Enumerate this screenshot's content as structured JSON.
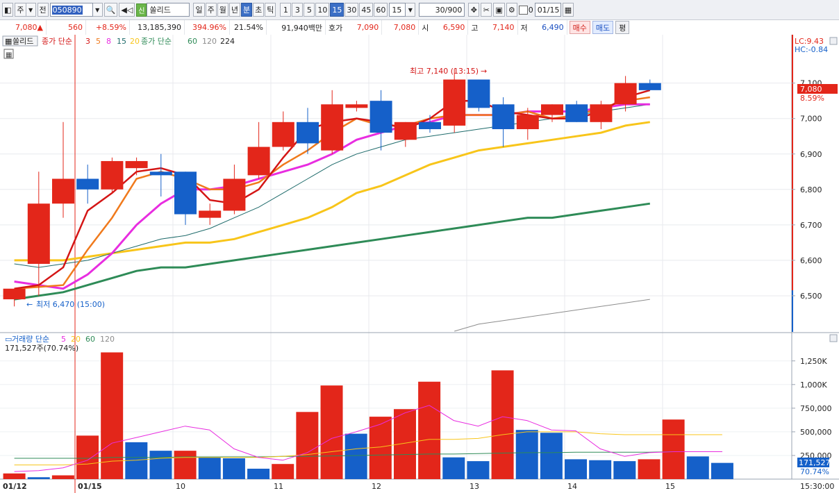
{
  "toolbar": {
    "type": "주",
    "range": "전",
    "code": "050890",
    "name_badge": "신",
    "name": "쏠리드",
    "periods": [
      "일",
      "주",
      "월",
      "년",
      "분",
      "초",
      "틱"
    ],
    "active_period": "분",
    "intervals": [
      "1",
      "3",
      "5",
      "10",
      "15",
      "30",
      "45",
      "60"
    ],
    "active_interval": "15",
    "interval_value": "15",
    "count": "30",
    "count_max": "/900",
    "checkbox_label": "0",
    "date": "01/15"
  },
  "quote": {
    "price": "7,080",
    "up_symbol": "▲",
    "change": "560",
    "change_pct": "+8.59%",
    "volume": "13,185,390",
    "volume_ratio": "394.96%",
    "turnover": "21.54%",
    "amount": "91,940백만",
    "bid_label": "호가",
    "bid1": "7,090",
    "bid2": "7,080",
    "open_label": "시",
    "open": "6,590",
    "high_label": "고",
    "high": "7,140",
    "low_label": "저",
    "low": "6,490",
    "buy_button": "매수",
    "sell_button": "매도",
    "avg_button": "평"
  },
  "chart": {
    "name_label": "쏠리드",
    "ma_label": "종가 단순",
    "ma_periods": [
      "3",
      "5",
      "8",
      "15",
      "20"
    ],
    "ma2_label": "종가 단순",
    "ma2_periods": [
      "60",
      "120",
      "224"
    ],
    "lc": "LC:9.43",
    "hc": "HC:-0.84",
    "current_price": "7,080",
    "current_pct": "8.59%",
    "high_annot": "최고 7,140 (13:15)",
    "low_annot": "최저 6,470 (15:00)",
    "vol_label": "거래량 단순",
    "vol_periods": [
      "5",
      "20",
      "60",
      "120"
    ],
    "vol_current": "171,527주(70.74%)",
    "vol_current_value": "171,527",
    "vol_current_pct": "70.74%",
    "time_label": "15:30:00",
    "colors": {
      "up": "#e3261a",
      "down": "#1560c9",
      "ma3": "#d41515",
      "ma5": "#f07a1c",
      "ma8": "#e82de0",
      "ma15": "#1d6a6a",
      "ma20": "#f8c51a",
      "ma60": "#2e8b57",
      "ma120": "#8c8c8c"
    }
  },
  "chart_data": {
    "type": "candlestick",
    "price_axis": {
      "ticks": [
        "7,100",
        "7,000",
        "6,900",
        "6,800",
        "6,700",
        "6,600",
        "6,500"
      ],
      "range": [
        6400,
        7200
      ]
    },
    "volume_axis": {
      "ticks": [
        "1,250K",
        "1,000K",
        "750,000",
        "500,000",
        "250,000"
      ],
      "range": [
        0,
        1350000
      ]
    },
    "x_labels": [
      "01/12",
      "01/15",
      "10",
      "11",
      "12",
      "13",
      "14",
      "15"
    ],
    "candles": [
      {
        "o": 6490,
        "h": 6520,
        "l": 6470,
        "c": 6520
      },
      {
        "o": 6590,
        "h": 6850,
        "l": 6500,
        "c": 6760
      },
      {
        "o": 6760,
        "h": 6990,
        "l": 6720,
        "c": 6830
      },
      {
        "o": 6830,
        "h": 6870,
        "l": 6760,
        "c": 6800
      },
      {
        "o": 6800,
        "h": 6890,
        "l": 6790,
        "c": 6880
      },
      {
        "o": 6860,
        "h": 6890,
        "l": 6840,
        "c": 6880
      },
      {
        "o": 6850,
        "h": 6900,
        "l": 6780,
        "c": 6840
      },
      {
        "o": 6850,
        "h": 6850,
        "l": 6700,
        "c": 6730
      },
      {
        "o": 6720,
        "h": 6760,
        "l": 6700,
        "c": 6740
      },
      {
        "o": 6740,
        "h": 6870,
        "l": 6730,
        "c": 6830
      },
      {
        "o": 6840,
        "h": 6990,
        "l": 6830,
        "c": 6920
      },
      {
        "o": 6920,
        "h": 7020,
        "l": 6910,
        "c": 6990
      },
      {
        "o": 6990,
        "h": 7030,
        "l": 6900,
        "c": 6930
      },
      {
        "o": 6910,
        "h": 7080,
        "l": 6900,
        "c": 7040
      },
      {
        "o": 7030,
        "h": 7050,
        "l": 7020,
        "c": 7040
      },
      {
        "o": 7050,
        "h": 7080,
        "l": 6910,
        "c": 6960
      },
      {
        "o": 6940,
        "h": 6990,
        "l": 6920,
        "c": 6990
      },
      {
        "o": 6990,
        "h": 7010,
        "l": 6960,
        "c": 6970
      },
      {
        "o": 6980,
        "h": 7140,
        "l": 6960,
        "c": 7110
      },
      {
        "o": 7110,
        "h": 7110,
        "l": 7020,
        "c": 7030
      },
      {
        "o": 7040,
        "h": 7060,
        "l": 6920,
        "c": 6970
      },
      {
        "o": 6970,
        "h": 7030,
        "l": 6940,
        "c": 7010
      },
      {
        "o": 7010,
        "h": 7040,
        "l": 6990,
        "c": 7040
      },
      {
        "o": 7040,
        "h": 7050,
        "l": 6990,
        "c": 6990
      },
      {
        "o": 6990,
        "h": 7050,
        "l": 6970,
        "c": 7040
      },
      {
        "o": 7040,
        "h": 7120,
        "l": 7020,
        "c": 7100
      },
      {
        "o": 7100,
        "h": 7110,
        "l": 7080,
        "c": 7080
      }
    ],
    "volumes": [
      {
        "v": 60000,
        "up": true
      },
      {
        "v": 20000,
        "up": false
      },
      {
        "v": 40000,
        "up": true
      },
      {
        "v": 460000,
        "up": true
      },
      {
        "v": 1340000,
        "up": true
      },
      {
        "v": 390000,
        "up": false
      },
      {
        "v": 300000,
        "up": false
      },
      {
        "v": 300000,
        "up": true
      },
      {
        "v": 230000,
        "up": false
      },
      {
        "v": 220000,
        "up": false
      },
      {
        "v": 110000,
        "up": false
      },
      {
        "v": 160000,
        "up": true
      },
      {
        "v": 710000,
        "up": true
      },
      {
        "v": 990000,
        "up": true
      },
      {
        "v": 480000,
        "up": false
      },
      {
        "v": 660000,
        "up": true
      },
      {
        "v": 740000,
        "up": true
      },
      {
        "v": 1030000,
        "up": true
      },
      {
        "v": 230000,
        "up": false
      },
      {
        "v": 190000,
        "up": false
      },
      {
        "v": 1150000,
        "up": true
      },
      {
        "v": 520000,
        "up": false
      },
      {
        "v": 490000,
        "up": false
      },
      {
        "v": 210000,
        "up": false
      },
      {
        "v": 200000,
        "up": false
      },
      {
        "v": 190000,
        "up": false
      },
      {
        "v": 210000,
        "up": true
      },
      {
        "v": 630000,
        "up": true
      },
      {
        "v": 240000,
        "up": false
      },
      {
        "v": 171527,
        "up": false
      }
    ],
    "ma_lines": {
      "ma3": [
        6520,
        6530,
        6580,
        6740,
        6790,
        6850,
        6860,
        6840,
        6770,
        6760,
        6800,
        6890,
        6970,
        6990,
        7000,
        6990,
        6970,
        7000,
        7050,
        7050,
        7020,
        7010,
        7000,
        7000,
        7020,
        7060,
        7080
      ],
      "ma5": [
        6520,
        6525,
        6530,
        6630,
        6720,
        6830,
        6850,
        6830,
        6800,
        6800,
        6820,
        6870,
        6910,
        6960,
        7000,
        6980,
        6980,
        7000,
        7010,
        7010,
        7010,
        7020,
        7000,
        7010,
        7030,
        7050,
        7060
      ],
      "ma8": [
        6540,
        6530,
        6520,
        6560,
        6620,
        6700,
        6760,
        6800,
        6800,
        6810,
        6830,
        6850,
        6870,
        6900,
        6940,
        6960,
        6980,
        6990,
        7010,
        7010,
        7010,
        7020,
        7020,
        7020,
        7030,
        7040,
        7040
      ],
      "ma15": [
        6590,
        6580,
        6590,
        6600,
        6620,
        6640,
        6660,
        6670,
        6690,
        6720,
        6750,
        6790,
        6830,
        6870,
        6900,
        6920,
        6940,
        6950,
        6960,
        6970,
        6980,
        6990,
        7000,
        7010,
        7020,
        7030,
        7040
      ],
      "ma20": [
        6600,
        6600,
        6600,
        6610,
        6620,
        6630,
        6640,
        6650,
        6650,
        6660,
        6680,
        6700,
        6720,
        6750,
        6790,
        6810,
        6840,
        6870,
        6890,
        6910,
        6920,
        6930,
        6940,
        6950,
        6960,
        6980,
        6990
      ],
      "ma60": [
        6490,
        6500,
        6510,
        6530,
        6550,
        6570,
        6580,
        6580,
        6590,
        6600,
        6610,
        6620,
        6630,
        6640,
        6650,
        6660,
        6670,
        6680,
        6690,
        6700,
        6710,
        6720,
        6720,
        6730,
        6740,
        6750,
        6760
      ],
      "ma120": [
        null,
        null,
        null,
        null,
        null,
        null,
        null,
        null,
        null,
        null,
        null,
        null,
        null,
        null,
        null,
        null,
        null,
        null,
        6400,
        6420,
        6430,
        6440,
        6450,
        6460,
        6470,
        6480,
        6490
      ]
    },
    "vol_ma5": [
      80000,
      90000,
      120000,
      200000,
      380000,
      440000,
      500000,
      560000,
      520000,
      320000,
      230000,
      200000,
      280000,
      430000,
      500000,
      580000,
      700000,
      780000,
      620000,
      560000,
      660000,
      620000,
      520000,
      510000,
      320000,
      240000,
      280000,
      290000,
      290000,
      290000
    ],
    "vol_ma20": [
      150000,
      150000,
      150000,
      160000,
      190000,
      200000,
      220000,
      230000,
      230000,
      230000,
      230000,
      240000,
      260000,
      290000,
      320000,
      340000,
      380000,
      420000,
      420000,
      430000,
      470000,
      500000,
      500000,
      500000,
      480000,
      470000,
      470000,
      470000,
      470000,
      470000
    ],
    "vol_ma60": [
      220000,
      220000,
      220000,
      220000,
      230000,
      230000,
      230000,
      235000,
      235000,
      235000,
      235000,
      240000,
      240000,
      245000,
      250000,
      255000,
      260000,
      265000,
      265000,
      270000,
      275000,
      280000,
      280000,
      285000,
      285000,
      285000,
      285000,
      290000,
      290000,
      290000
    ]
  }
}
